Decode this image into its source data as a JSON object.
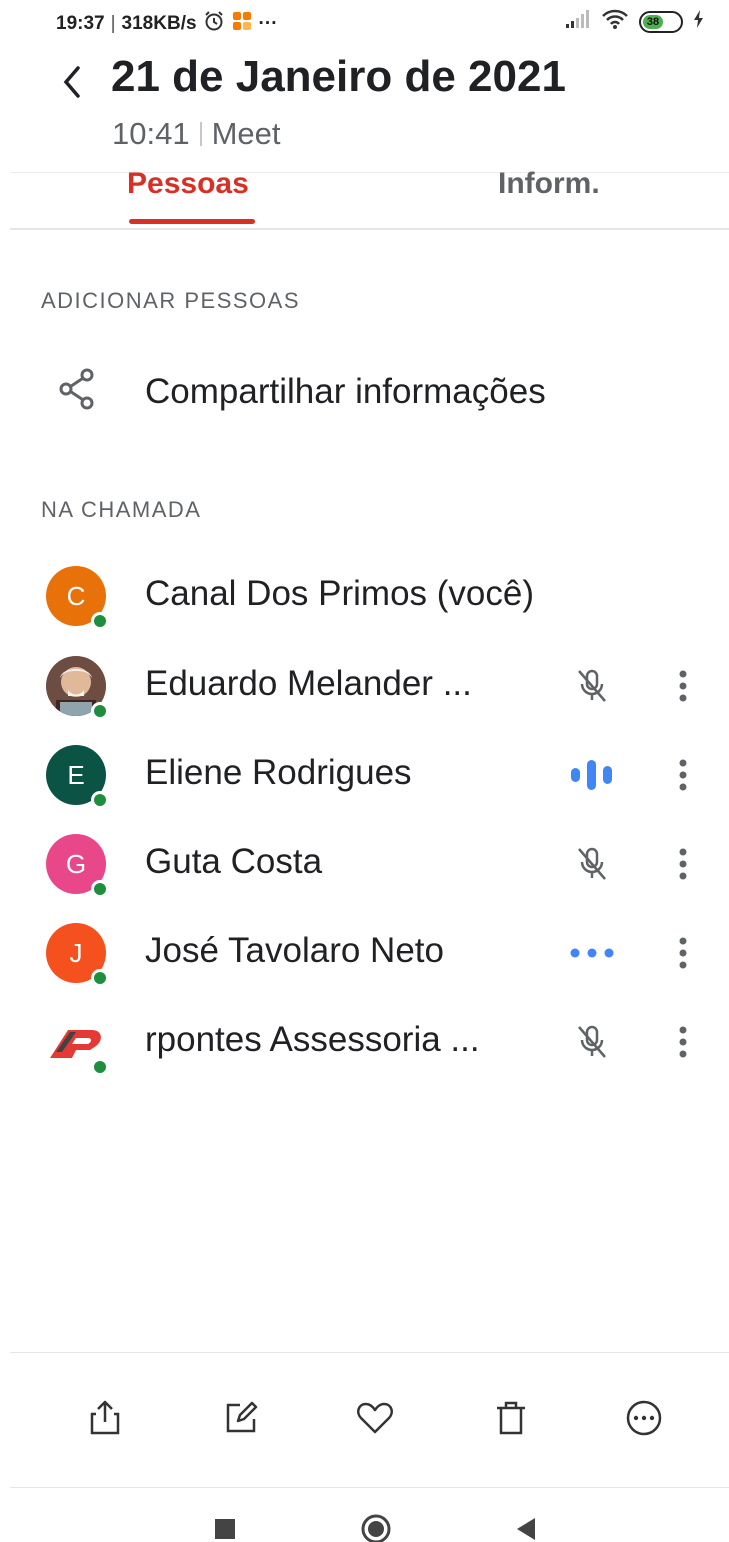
{
  "status_bar": {
    "time": "19:37",
    "speed": "318KB/s",
    "more": "···",
    "battery": "38",
    "battery_color": "#4caf50"
  },
  "header": {
    "title": "21 de Janeiro de 2021",
    "time": "10:41",
    "app": "Meet"
  },
  "tabs": [
    {
      "label": "Pessoas",
      "active": true
    },
    {
      "label": "Inform.",
      "active": false
    }
  ],
  "add_section": {
    "label": "ADICIONAR PESSOAS",
    "share_label": "Compartilhar informações"
  },
  "call_section": {
    "label": "NA CHAMADA"
  },
  "participants": [
    {
      "initial": "C",
      "name": "Canal Dos Primos (você)",
      "avatar_color": "#e8710a",
      "state": "none"
    },
    {
      "initial": "",
      "name": "Eduardo Melander ...",
      "avatar_color": "#8d6e63",
      "state": "muted"
    },
    {
      "initial": "E",
      "name": "Eliene Rodrigues",
      "avatar_color": "#0b5345",
      "state": "speaking"
    },
    {
      "initial": "G",
      "name": "Guta Costa",
      "avatar_color": "#e8488a",
      "state": "muted"
    },
    {
      "initial": "J",
      "name": "José Tavolaro Neto",
      "avatar_color": "#f4511e",
      "state": "dots"
    },
    {
      "initial": "",
      "name": "rpontes Assessoria ...",
      "avatar_color": "#ffffff",
      "state": "muted"
    }
  ],
  "colors": {
    "accent": "#d93025",
    "online": "#1e8e3e",
    "speaking": "#4285f4"
  },
  "actions": [
    "share-icon",
    "edit-icon",
    "heart-icon",
    "trash-icon",
    "more-horizontal-icon"
  ],
  "nav": [
    "recents-icon",
    "home-icon",
    "back-icon"
  ]
}
